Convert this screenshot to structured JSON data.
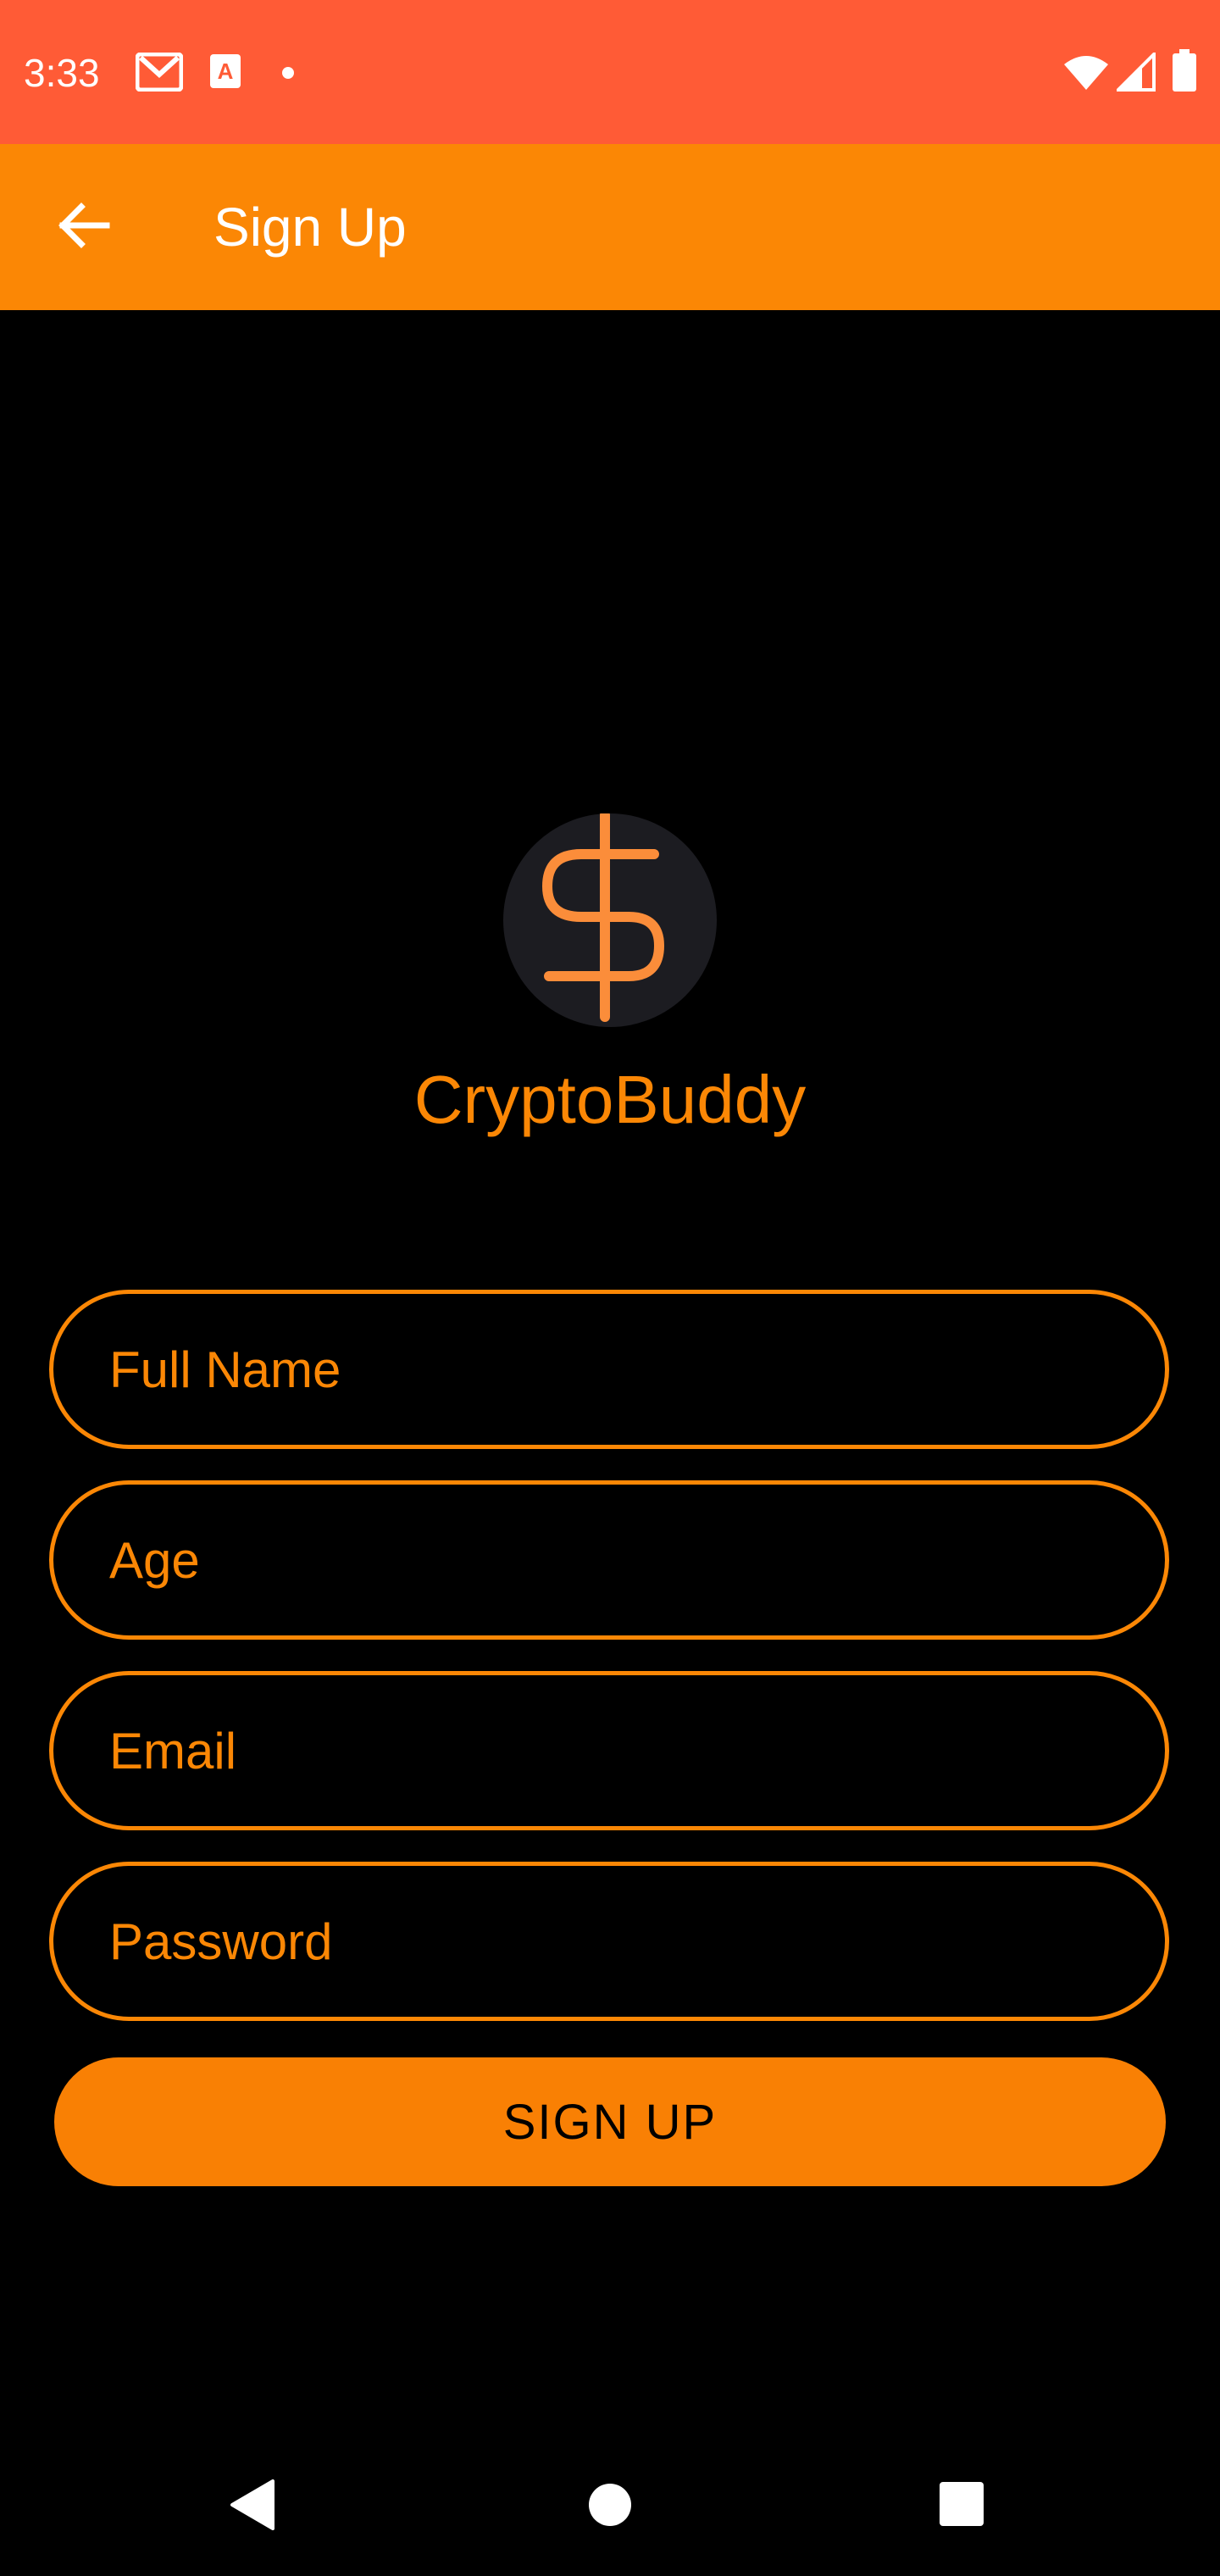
{
  "status_bar": {
    "time": "3:33",
    "icons": [
      "gmail-icon",
      "text-a-icon",
      "notification-dot-icon",
      "wifi-icon",
      "cell-signal-icon",
      "battery-icon"
    ],
    "background_color": "#ff5b36"
  },
  "app_bar": {
    "title": "Sign Up",
    "back_icon": "arrow-left-icon",
    "background_color": "#fb8705"
  },
  "logo": {
    "icon": "dollar-sign-icon",
    "app_name": "CryptoBuddy"
  },
  "form": {
    "full_name": {
      "placeholder": "Full Name",
      "value": ""
    },
    "age": {
      "placeholder": "Age",
      "value": ""
    },
    "email": {
      "placeholder": "Email",
      "value": ""
    },
    "password": {
      "placeholder": "Password",
      "value": ""
    },
    "submit_label": "SIGN UP"
  },
  "nav_bar": {
    "icons": [
      "nav-back-icon",
      "nav-home-icon",
      "nav-recents-icon"
    ]
  },
  "colors": {
    "accent": "#fb8705",
    "background": "#000000",
    "logo_circle": "#1c1c21"
  }
}
